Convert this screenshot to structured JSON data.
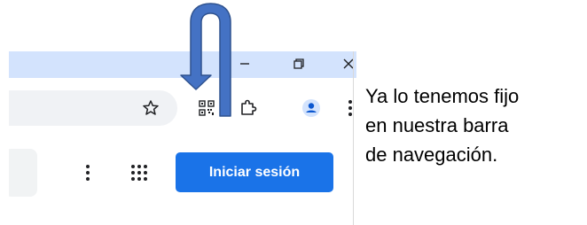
{
  "browser": {
    "window_controls": {
      "minimize_icon": "minimize-icon",
      "restore_icon": "restore-icon",
      "close_icon": "close-icon"
    },
    "toolbar": {
      "bookmark_icon": "star-icon",
      "qr_icon": "qr-code-icon",
      "extensions_icon": "puzzle-piece-icon",
      "profile_icon": "profile-avatar-icon",
      "menu_icon": "vertical-dots-icon"
    },
    "page": {
      "menu_icon": "vertical-dots-icon",
      "apps_icon": "apps-grid-icon",
      "signin_label": "Iniciar sesión"
    }
  },
  "annotation": {
    "arrow_icon": "u-turn-down-arrow",
    "caption_lines": [
      "Ya lo tenemos fijo",
      "en nuestra barra",
      "de navegación."
    ]
  },
  "colors": {
    "titlebar": "#d3e3fd",
    "omnibox": "#f0f2f5",
    "signin_button": "#1a73e8",
    "arrow_fill": "#4472c4",
    "arrow_stroke": "#2f528f",
    "profile_avatar": "#1a73e8"
  }
}
